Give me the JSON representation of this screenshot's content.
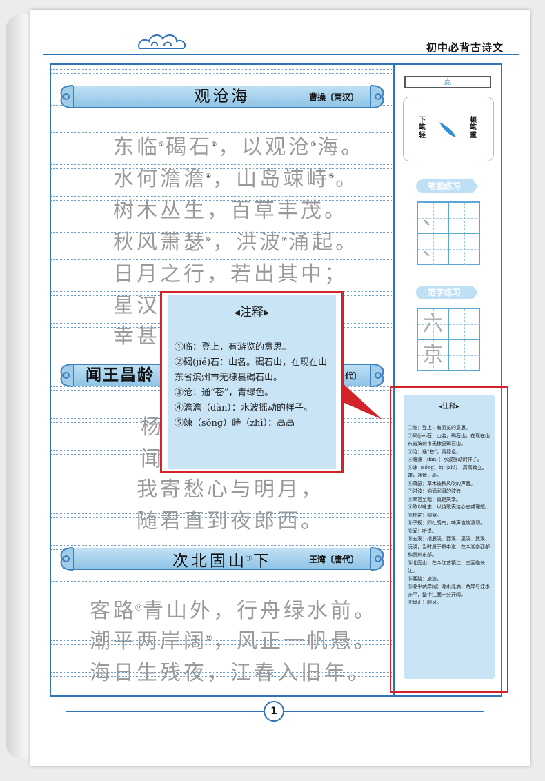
{
  "header": {
    "title": "初中必背古诗文"
  },
  "poems": [
    {
      "title": "观沧海",
      "author": "曹操〔两汉〕",
      "lines": [
        [
          {
            "t": "东临"
          },
          {
            "n": "①"
          },
          {
            "t": "碣石"
          },
          {
            "n": "②"
          },
          {
            "t": "，以观沧"
          },
          {
            "n": "③"
          },
          {
            "t": "海。"
          }
        ],
        [
          {
            "t": "水何澹澹"
          },
          {
            "n": "④"
          },
          {
            "t": "，山岛竦峙"
          },
          {
            "n": "⑤"
          },
          {
            "t": "。"
          }
        ],
        [
          {
            "t": "树木丛生，百草丰茂。"
          }
        ],
        [
          {
            "t": "秋风萧瑟"
          },
          {
            "n": "⑥"
          },
          {
            "t": "，洪波"
          },
          {
            "n": "⑦"
          },
          {
            "t": "涌起。"
          }
        ],
        [
          {
            "t": "日月之行，若出其中；"
          }
        ],
        [
          {
            "t": "星汉"
          }
        ],
        [
          {
            "t": "幸甚"
          }
        ]
      ]
    },
    {
      "title": "闻王昌龄",
      "author": "代〕",
      "lines": [
        [
          {
            "t": "杨"
          }
        ],
        [
          {
            "t": "闻"
          }
        ],
        [
          {
            "t": "我寄愁心与明月，"
          }
        ],
        [
          {
            "t": "随君直到夜郎西。"
          }
        ]
      ]
    },
    {
      "title_parts": [
        {
          "t": "次北固山"
        },
        {
          "n": "⑪"
        },
        {
          "t": "下"
        }
      ],
      "author": "王湾〔唐代〕",
      "lines": [
        [
          {
            "t": "客路"
          },
          {
            "n": "⑫"
          },
          {
            "t": "青山外，行舟绿水前。"
          }
        ],
        [
          {
            "t": "潮平两岸阔"
          },
          {
            "n": "⑬"
          },
          {
            "t": "，风正一帆悬。"
          }
        ],
        [
          {
            "t": "海日生残夜，江春入旧年。"
          }
        ]
      ]
    }
  ],
  "popup": {
    "title": "◂注释▸",
    "body": [
      "①临：登上，有游览的意思。",
      "②碣(jié)石：山名。碣石山，在现在山东省滨州市无棣县碣石山。",
      "③沧：通“苍”，青绿色。",
      "④澹澹（dàn）：水波摇动的样子。",
      "⑤竦（sǒng）峙（zhì）：高高"
    ]
  },
  "side_notes": {
    "title": "◂注释▸",
    "body": [
      "①临：登上，有游览的意思。",
      "②碣(jié)石：山名，碣石山，在现在山东省滨州市无棣县碣石山。",
      "③沧：通“苍”，青绿色。",
      "④澹澹（dàn）：水波摇动的样子。",
      "⑤竦（sǒng）峙（zhì）：高高耸立。竦，通耸，高。",
      "⑥萧瑟：草木被秋风吹的声音。",
      "⑦洪波：汹涌澎湃的波浪",
      "⑧幸甚至哉：真是庆幸。",
      "⑨歌以咏志：以诗歌表达心志或理想。",
      "⑩杨花：柳絮。",
      "⑪子规：即杜鹃鸟，啼声哀婉凄切。",
      "⑫闻：听说。",
      "⑬五溪：指辰溪、酉溪、巫溪、武溪、沅溪，当时属于黔中道，在今湖南西部和贵州东部。",
      "⑭北固山：在今江苏镇江，三面临长江。",
      "⑮客路：旅途。",
      "⑯潮平两岸阔：潮水涨满，两岸与江水齐平，整个江面十分开阔。",
      "⑰风正：顺风。"
    ]
  },
  "right_panel": {
    "top_label": "点",
    "stroke_left": "下笔轻",
    "stroke_right": "顿笔重",
    "tag1": "笔画练习",
    "tag2": "范字练习",
    "grid1_chars": [
      "、",
      "",
      "、",
      ""
    ],
    "grid2_chars": [
      "六",
      "",
      "京",
      ""
    ]
  },
  "footer": {
    "page_number": "1"
  },
  "colors": {
    "accent_blue": "#2f74b8",
    "highlight_red": "#d2232a",
    "note_bg": "#c9e4f5"
  }
}
